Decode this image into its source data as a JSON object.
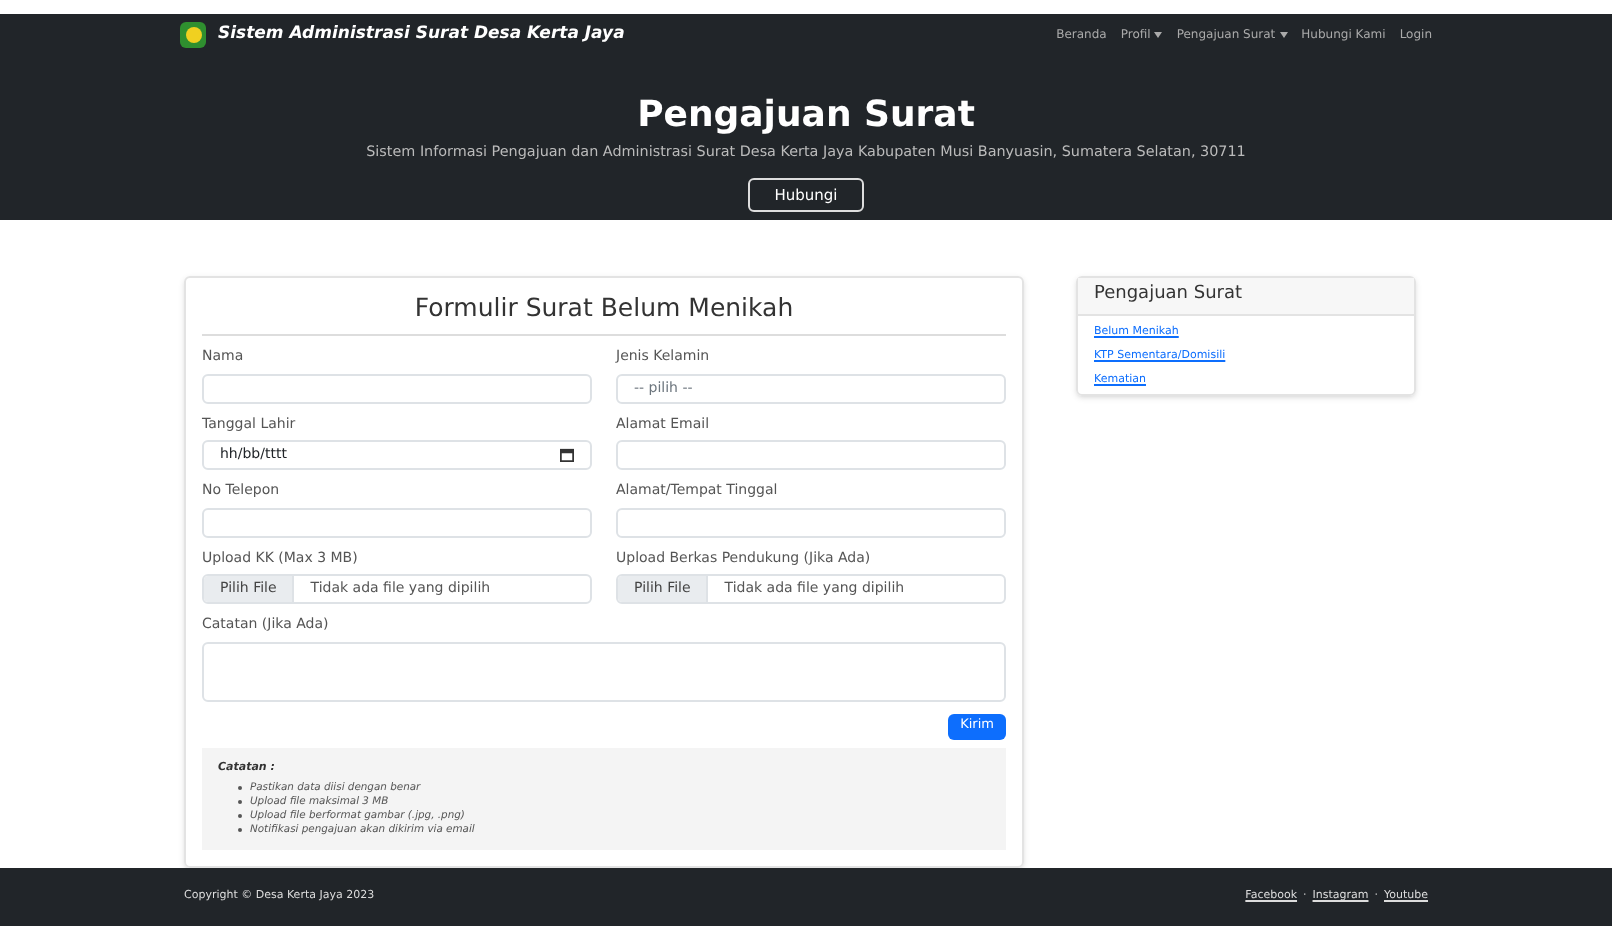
{
  "navbar": {
    "brand": "Sistem Administrasi Surat Desa Kerta Jaya",
    "items": [
      {
        "label": "Beranda",
        "dropdown": false
      },
      {
        "label": "Profil",
        "dropdown": true
      },
      {
        "label": "Pengajuan Surat",
        "dropdown": true
      },
      {
        "label": "Hubungi Kami",
        "dropdown": false
      },
      {
        "label": "Login",
        "dropdown": false
      }
    ]
  },
  "hero": {
    "title": "Pengajuan Surat",
    "subtitle": "Sistem Informasi Pengajuan dan Administrasi Surat Desa Kerta Jaya Kabupaten Musi Banyuasin, Sumatera Selatan, 30711",
    "button": "Hubungi"
  },
  "form": {
    "title": "Formulir Surat Belum Menikah",
    "fields": [
      {
        "kind": "text",
        "label": "Nama"
      },
      {
        "kind": "select",
        "label": "Jenis Kelamin",
        "placeholder": "-- pilih --"
      },
      {
        "kind": "date",
        "label": "Tanggal Lahir",
        "placeholder": "hh/bb/tttt"
      },
      {
        "kind": "text",
        "label": "Alamat Email"
      },
      {
        "kind": "text",
        "label": "No Telepon"
      },
      {
        "kind": "text",
        "label": "Alamat/Tempat Tinggal"
      },
      {
        "kind": "file",
        "label": "Upload KK (Max 3 MB)",
        "button": "Pilih File",
        "status": "Tidak ada file yang dipilih"
      },
      {
        "kind": "file",
        "label": "Upload Berkas Pendukung (Jika Ada)",
        "button": "Pilih File",
        "status": "Tidak ada file yang dipilih"
      }
    ],
    "notes_label": "Catatan (Jika Ada)",
    "submit": "Kirim",
    "info": {
      "title": "Catatan :",
      "items": [
        "Pastikan data diisi dengan benar",
        "Upload file maksimal 3 MB",
        "Upload file berformat gambar (.jpg, .png)",
        "Notifikasi pengajuan akan dikirim via email"
      ]
    }
  },
  "sidebar": {
    "title": "Pengajuan Surat",
    "links": [
      "Belum Menikah",
      "KTP Sementara/Domisili",
      "Kematian"
    ]
  },
  "footer": {
    "copyright": "Copyright © Desa Kerta Jaya 2023",
    "links": [
      "Facebook",
      "Instagram",
      "Youtube"
    ],
    "separator": "·"
  }
}
